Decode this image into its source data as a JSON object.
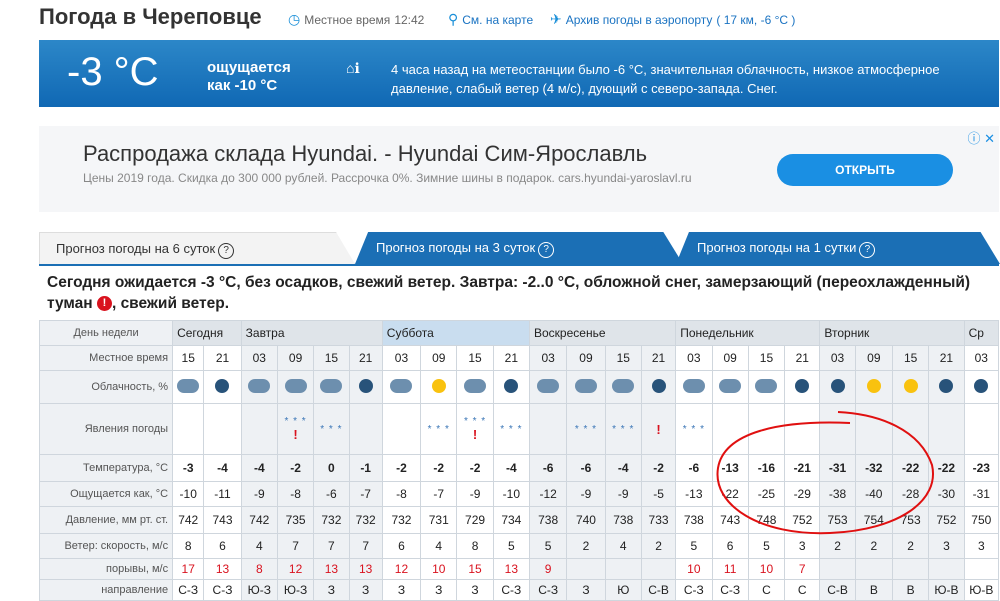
{
  "header": {
    "title": "Погода в Череповце",
    "local_time_label": "Местное время",
    "local_time": "12:42",
    "map_link": "См. на карте",
    "airport_archive": "Архив погоды в аэропорту",
    "airport_info": "( 17 км, -6 °C )"
  },
  "now": {
    "temperature": "-3 °C",
    "feels_like": "ощущается как -10 °C",
    "description": "4 часа назад на метеостанции было -6 °C, значительная облачность, низкое атмосферное давление, слабый ветер (4 м/с), дующий с северо-запада. Снег."
  },
  "ad": {
    "title": "Распродажа склада Hyundai. - Hyundai Сим-Ярославль",
    "text": "Цены 2019 года. Скидка до 300 000 рублей. Рассрочка 0%. Зимние шины в подарок. cars.hyundai-yaroslavl.ru",
    "button": "ОТКРЫТЬ",
    "marks": "ⓘ ✕"
  },
  "tabs": [
    "Прогноз погоды на 6 суток",
    "Прогноз погоды на 3 суток",
    "Прогноз погоды на 1 сутки"
  ],
  "summary": "Сегодня ожидается -3 °C, без осадков, свежий ветер. Завтра: -2..0 °C, обложной снег, замерзающий (переохлажденный) туман",
  "summary_end": ", свежий ветер.",
  "summary_icon": "!",
  "table": {
    "labels": {
      "day": "День недели",
      "time": "Местное время",
      "cloud": "Облачность, %",
      "phenomena": "Явления погоды",
      "temp": "Температура, °C",
      "feels": "Ощущается как, °C",
      "pressure": "Давление, мм рт. ст.",
      "wind": "Ветер: скорость, м/с",
      "gusts": "порывы, м/с",
      "direction": "направление"
    },
    "days": [
      "Сегодня",
      "Завтра",
      "Суббота",
      "Воскресенье",
      "Понедельник",
      "Вторник",
      "Ср"
    ],
    "times": [
      "15",
      "21",
      "03",
      "09",
      "15",
      "21",
      "03",
      "09",
      "15",
      "21",
      "03",
      "09",
      "15",
      "21",
      "03",
      "09",
      "15",
      "21",
      "03",
      "09",
      "15",
      "21",
      "03"
    ],
    "temps": [
      "-3",
      "-4",
      "-4",
      "-2",
      "0",
      "-1",
      "-2",
      "-2",
      "-2",
      "-4",
      "-6",
      "-6",
      "-4",
      "-2",
      "-6",
      "-13",
      "-16",
      "-21",
      "-31",
      "-32",
      "-22",
      "-22",
      "-23"
    ],
    "feels": [
      "-10",
      "-11",
      "-9",
      "-8",
      "-6",
      "-7",
      "-8",
      "-7",
      "-9",
      "-10",
      "-12",
      "-9",
      "-9",
      "-5",
      "-13",
      "-22",
      "-25",
      "-29",
      "-38",
      "-40",
      "-28",
      "-30",
      "-31"
    ],
    "pressure": [
      "742",
      "743",
      "742",
      "735",
      "732",
      "732",
      "732",
      "731",
      "729",
      "734",
      "738",
      "740",
      "738",
      "733",
      "738",
      "743",
      "748",
      "752",
      "753",
      "754",
      "753",
      "752",
      "750"
    ],
    "wind": [
      "8",
      "6",
      "4",
      "7",
      "7",
      "7",
      "6",
      "4",
      "8",
      "5",
      "5",
      "2",
      "4",
      "2",
      "5",
      "6",
      "5",
      "3",
      "2",
      "2",
      "2",
      "3",
      "3"
    ],
    "gusts": [
      "17",
      "13",
      "8",
      "12",
      "13",
      "13",
      "12",
      "10",
      "15",
      "13",
      "9",
      "",
      "",
      "",
      "10",
      "11",
      "10",
      "7",
      "",
      "",
      "",
      "",
      ""
    ],
    "direction": [
      "С-З",
      "С-З",
      "Ю-З",
      "Ю-З",
      "З",
      "З",
      "З",
      "З",
      "З",
      "С-З",
      "С-З",
      "З",
      "Ю",
      "С-В",
      "С-З",
      "С-З",
      "С",
      "С",
      "С-В",
      "В",
      "В",
      "Ю-В",
      "Ю-В"
    ],
    "cloud_icons": [
      "cloud",
      "moon",
      "cloud",
      "cloud",
      "cloud",
      "moon",
      "cloud",
      "sun",
      "cloud",
      "moon",
      "cloud",
      "cloud",
      "cloud",
      "moon",
      "cloud",
      "cloud",
      "cloud",
      "moon",
      "moon",
      "sun",
      "sun",
      "moon",
      "moon"
    ],
    "phen": [
      "",
      "",
      "",
      "snow",
      "snow",
      "",
      "",
      "snow",
      "snow",
      "snow",
      "",
      "snow",
      "snow",
      "",
      "snow",
      "",
      "",
      "",
      "",
      "",
      "",
      "",
      ""
    ],
    "warn": [
      "",
      "",
      "",
      "!",
      "",
      "",
      "",
      "",
      "!",
      "",
      "",
      "",
      "",
      "!",
      "",
      "",
      "",
      "",
      "",
      "",
      "",
      "",
      ""
    ]
  },
  "colors": {
    "accent": "#1b6fb5",
    "cold": "#1ba2c2",
    "warm": "#f07000",
    "annotation": "#e01010"
  }
}
